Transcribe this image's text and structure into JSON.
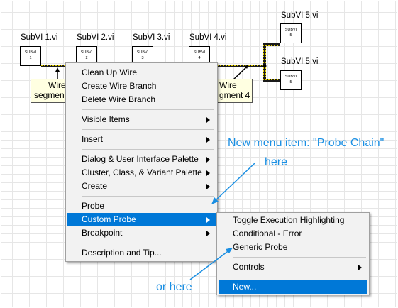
{
  "subvis": [
    {
      "title": "SubVI 1.vi",
      "label": "SUBVI",
      "num": "1"
    },
    {
      "title": "SubVI 2.vi",
      "label": "SUBVI",
      "num": "2"
    },
    {
      "title": "SubVI 3.vi",
      "label": "SUBVI",
      "num": "3"
    },
    {
      "title": "SubVI 4.vi",
      "label": "SUBVI",
      "num": "4"
    },
    {
      "title": "SubVI 5.vi",
      "label": "SUBVI",
      "num": "5"
    },
    {
      "title": "SubVI 5.vi",
      "label": "SUBVI",
      "num": "5"
    }
  ],
  "notes": {
    "left_line1": "Wire",
    "left_line2": "segmen",
    "right_line1": "Wire",
    "right_line2": "gment 4"
  },
  "context_menu": {
    "items": [
      {
        "label": "Clean Up Wire"
      },
      {
        "label": "Create Wire Branch"
      },
      {
        "label": "Delete Wire Branch"
      },
      {
        "label": "Visible Items"
      },
      {
        "label": "Insert"
      },
      {
        "label": "Dialog & User Interface Palette"
      },
      {
        "label": "Cluster, Class, & Variant Palette"
      },
      {
        "label": "Create"
      },
      {
        "label": "Probe"
      },
      {
        "label": "Custom Probe"
      },
      {
        "label": "Breakpoint"
      },
      {
        "label": "Description and Tip..."
      }
    ]
  },
  "submenu": {
    "items": [
      {
        "label": "Toggle Execution Highlighting"
      },
      {
        "label": "Conditional - Error"
      },
      {
        "label": "Generic Probe"
      },
      {
        "label": "Controls"
      },
      {
        "label": "New..."
      }
    ]
  },
  "callouts": {
    "top_line1": "New menu item: \"Probe Chain\"",
    "top_line2": "here",
    "bottom": "or here"
  },
  "colors": {
    "highlight": "#0078d7",
    "callout": "#1a8fe3",
    "wire": "#d9c800"
  }
}
